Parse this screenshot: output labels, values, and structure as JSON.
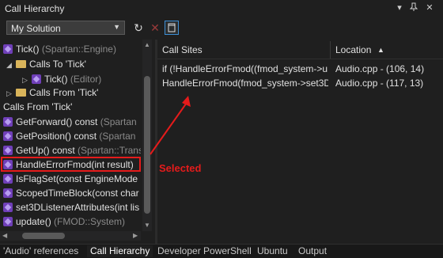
{
  "window": {
    "title": "Call Hierarchy",
    "icons": [
      "chevron-down-icon",
      "pin-icon",
      "close-icon"
    ]
  },
  "toolbar": {
    "scope_value": "My Solution",
    "icons": [
      "refresh-icon",
      "cancel-icon",
      "toggle-details-icon"
    ]
  },
  "tree": {
    "items": [
      {
        "label": "Tick()",
        "context": "(Spartan::Engine)",
        "icon": "method-icon"
      },
      {
        "label": "Calls To 'Tick'",
        "context": "",
        "icon": "folder-icon"
      },
      {
        "label": "Tick()",
        "context": "(Editor)",
        "icon": "method-icon"
      },
      {
        "label": "Calls From 'Tick'",
        "context": "",
        "icon": "folder-icon"
      },
      {
        "label": "Calls From 'Tick'",
        "context": "",
        "icon": ""
      },
      {
        "label": "GetForward() const",
        "context": "(Spartan",
        "icon": "method-icon"
      },
      {
        "label": "GetPosition() const",
        "context": "(Spartan",
        "icon": "method-icon"
      },
      {
        "label": "GetUp() const",
        "context": "(Spartan::Trans",
        "icon": "method-icon"
      },
      {
        "label": "HandleErrorFmod(int result)",
        "context": "",
        "icon": "method-icon"
      },
      {
        "label": "IsFlagSet(const EngineMode",
        "context": "",
        "icon": "method-icon"
      },
      {
        "label": "ScopedTimeBlock(const char",
        "context": "",
        "icon": "method-icon"
      },
      {
        "label": "set3DListenerAttributes(int lis",
        "context": "",
        "icon": "method-icon"
      },
      {
        "label": "update()",
        "context": "(FMOD::System)",
        "icon": "method-icon"
      }
    ]
  },
  "details": {
    "columns": {
      "call_sites": "Call Sites",
      "location": "Location"
    },
    "sort_icon": "sort-ascending-icon",
    "rows": [
      {
        "call_site": "if (!HandleErrorFmod((fmod_system->u",
        "location": "Audio.cpp - (106, 14)"
      },
      {
        "call_site": "HandleErrorFmod(fmod_system->set3D",
        "location": "Audio.cpp - (117, 13)"
      }
    ]
  },
  "annotation": {
    "label": "Selected",
    "color": "#e51b1b"
  },
  "tabs": [
    "'Audio' references",
    "Call Hierarchy",
    "Developer PowerShell",
    "Ubuntu",
    "Output"
  ],
  "colors": {
    "accent_selected_border": "#e51b1b",
    "method_icon": "#6f3fb8",
    "folder_icon": "#d9b45a"
  }
}
